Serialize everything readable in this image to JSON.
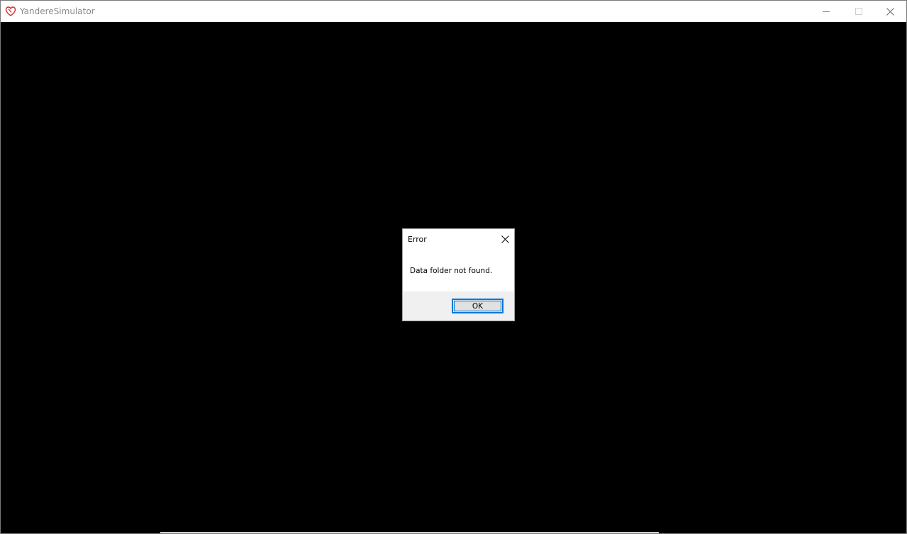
{
  "window": {
    "title": "YandereSimulator",
    "icon": "heart-icon",
    "icon_color": "#d42a2a",
    "controls": {
      "minimize": "minimize-icon",
      "maximize": "maximize-icon",
      "close": "close-icon"
    }
  },
  "dialog": {
    "title": "Error",
    "message": "Data folder not found.",
    "ok_label": "OK",
    "accent_color": "#0078d7"
  }
}
